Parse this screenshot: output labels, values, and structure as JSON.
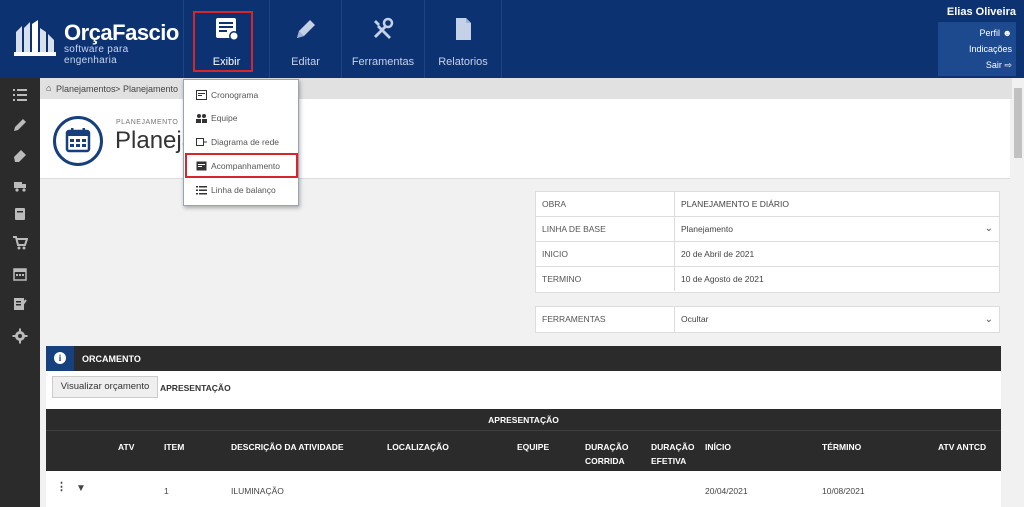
{
  "app": {
    "logo_name": "OrçaFascio",
    "logo_tagline": "software para engenharia"
  },
  "topnav": {
    "items": [
      {
        "label": "Exibir",
        "icon": "view-list-icon"
      },
      {
        "label": "Editar",
        "icon": "pencil-icon"
      },
      {
        "label": "Ferramentas",
        "icon": "tools-icon"
      },
      {
        "label": "Relatorios",
        "icon": "document-icon"
      }
    ]
  },
  "user": {
    "name": "Elias Oliveira",
    "links": [
      "Perfil",
      "Indicações",
      "Sair"
    ]
  },
  "dropdown": {
    "items": [
      "Cronograma",
      "Equipe",
      "Diagrama de rede",
      "Acompanhamento",
      "Linha de balanço"
    ]
  },
  "breadcrumb": {
    "items": [
      "Planejamentos",
      "Planejamento"
    ]
  },
  "page": {
    "small_label": "PLANEJAMENTO",
    "title": "Planejamento"
  },
  "info": {
    "rows": [
      {
        "label": "OBRA",
        "value": "PLANEJAMENTO E DIÁRIO"
      },
      {
        "label": "LINHA DE BASE",
        "value": "Planejamento"
      },
      {
        "label": "INICIO",
        "value": "20 de Abril de 2021"
      },
      {
        "label": "TERMINO",
        "value": "10 de Agosto de 2021"
      }
    ],
    "tools_label": "FERRAMENTAS",
    "tools_value": "Ocultar"
  },
  "orcamento": {
    "title": "ORCAMENTO",
    "button": "Visualizar orçamento",
    "presentation_label": "APRESENTAÇÃO"
  },
  "table": {
    "title": "APRESENTAÇÃO",
    "columns": [
      "ATV",
      "ITEM",
      "DESCRIÇÃO DA ATIVIDADE",
      "LOCALIZAÇÃO",
      "EQUIPE",
      "DURAÇÃO CORRIDA",
      "DURAÇÃO EFETIVA",
      "INÍCIO",
      "TÉRMINO",
      "ATV ANTCD"
    ],
    "rows": [
      {
        "item": "1",
        "descricao": "ILUMINAÇÃO",
        "inicio": "20/04/2021",
        "termino": "10/08/2021"
      }
    ]
  },
  "colors": {
    "topbar": "#0d3272",
    "sidebar": "#2b2b2b",
    "highlight": "#d6262b"
  }
}
